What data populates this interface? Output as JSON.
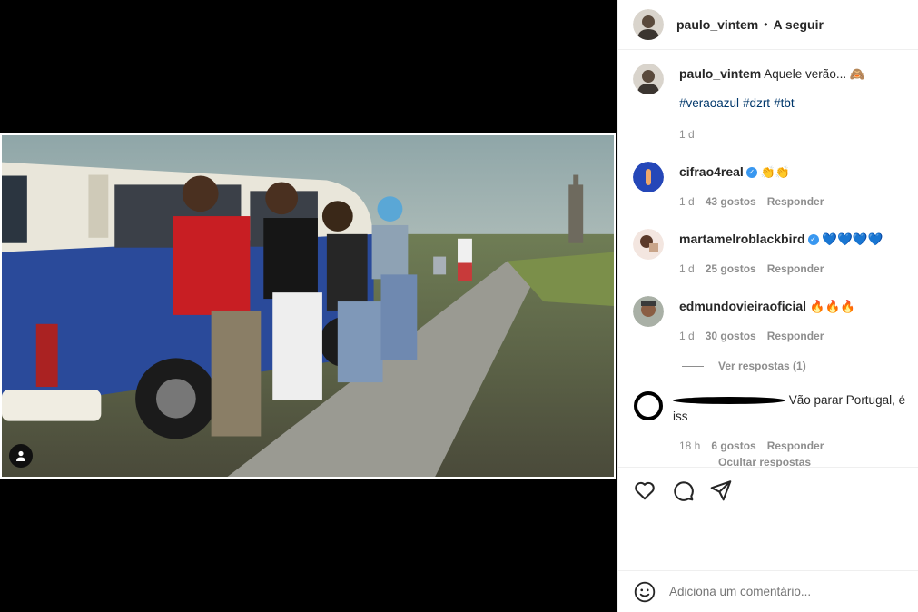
{
  "post": {
    "author": "paulo_vintem",
    "follow_label": "A seguir",
    "separator": "•"
  },
  "caption": {
    "author": "paulo_vintem",
    "text": "Aquele verão... 🙈",
    "hashtags": [
      "#veraoazul",
      "#dzrt",
      "#tbt"
    ],
    "time": "1 d"
  },
  "comments": [
    {
      "user": "cifrao4real",
      "verified": true,
      "text": "👏👏",
      "time": "1 d",
      "likes": "43 gostos",
      "reply": "Responder"
    },
    {
      "user": "martamelroblackbird",
      "verified": true,
      "text": "💙💙💙💙",
      "time": "1 d",
      "likes": "25 gostos",
      "reply": "Responder"
    },
    {
      "user": "edmundovieiraoficial",
      "verified": false,
      "text": "🔥🔥🔥",
      "time": "1 d",
      "likes": "30 gostos",
      "reply": "Responder"
    }
  ],
  "view_replies": "Ver respostas (1)",
  "reply_comment": {
    "text": "Vão parar Portugal, é iss",
    "time": "18 h",
    "likes": "6 gostos",
    "reply": "Responder"
  },
  "hide_replies": "Ocultar respostas",
  "add_comment": {
    "placeholder": "Adiciona um comentário..."
  },
  "icons": {
    "like": "heart-icon",
    "comment": "comment-icon",
    "share": "send-icon",
    "emoji": "emoji-icon",
    "tags": "person-tag-icon"
  },
  "colors": {
    "hashtag": "#00376b",
    "verified": "#3897f0",
    "muted": "#8e8e8e"
  }
}
